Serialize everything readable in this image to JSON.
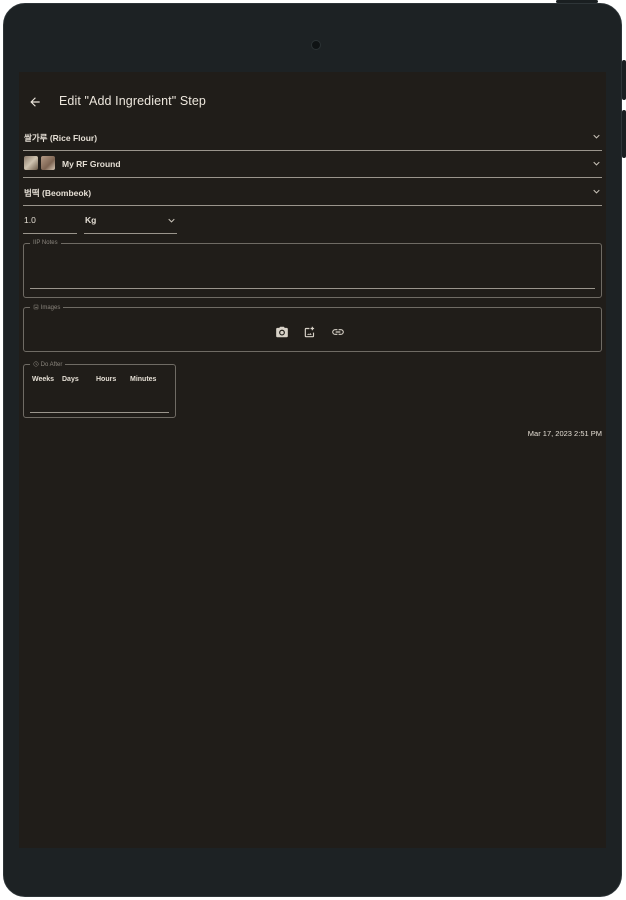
{
  "app": {
    "title": "Edit \"Add Ingredient\" Step"
  },
  "form": {
    "ingredient": "쌀가루 (Rice Flour)",
    "item": "My RF Ground",
    "recipe": "범떡 (Beombeok)",
    "quantity": "1.0",
    "unit": "Kg",
    "notes_legend": "IIP Notes",
    "images_legend": "Images",
    "do_after_legend": "Do After",
    "do_after_headers": [
      "Weeks",
      "Days",
      "Hours",
      "Minutes"
    ],
    "timestamp": "Mar 17, 2023 2:51 PM"
  },
  "icons": [
    "back-arrow-icon",
    "chevron-down-icon",
    "camera-icon",
    "add-photo-icon",
    "link-icon",
    "image-icon",
    "clock-icon"
  ],
  "colors": {
    "background": "#201d19",
    "text": "#e8e2d8",
    "divider": "#9a958c",
    "bezel": "#1d2224"
  }
}
